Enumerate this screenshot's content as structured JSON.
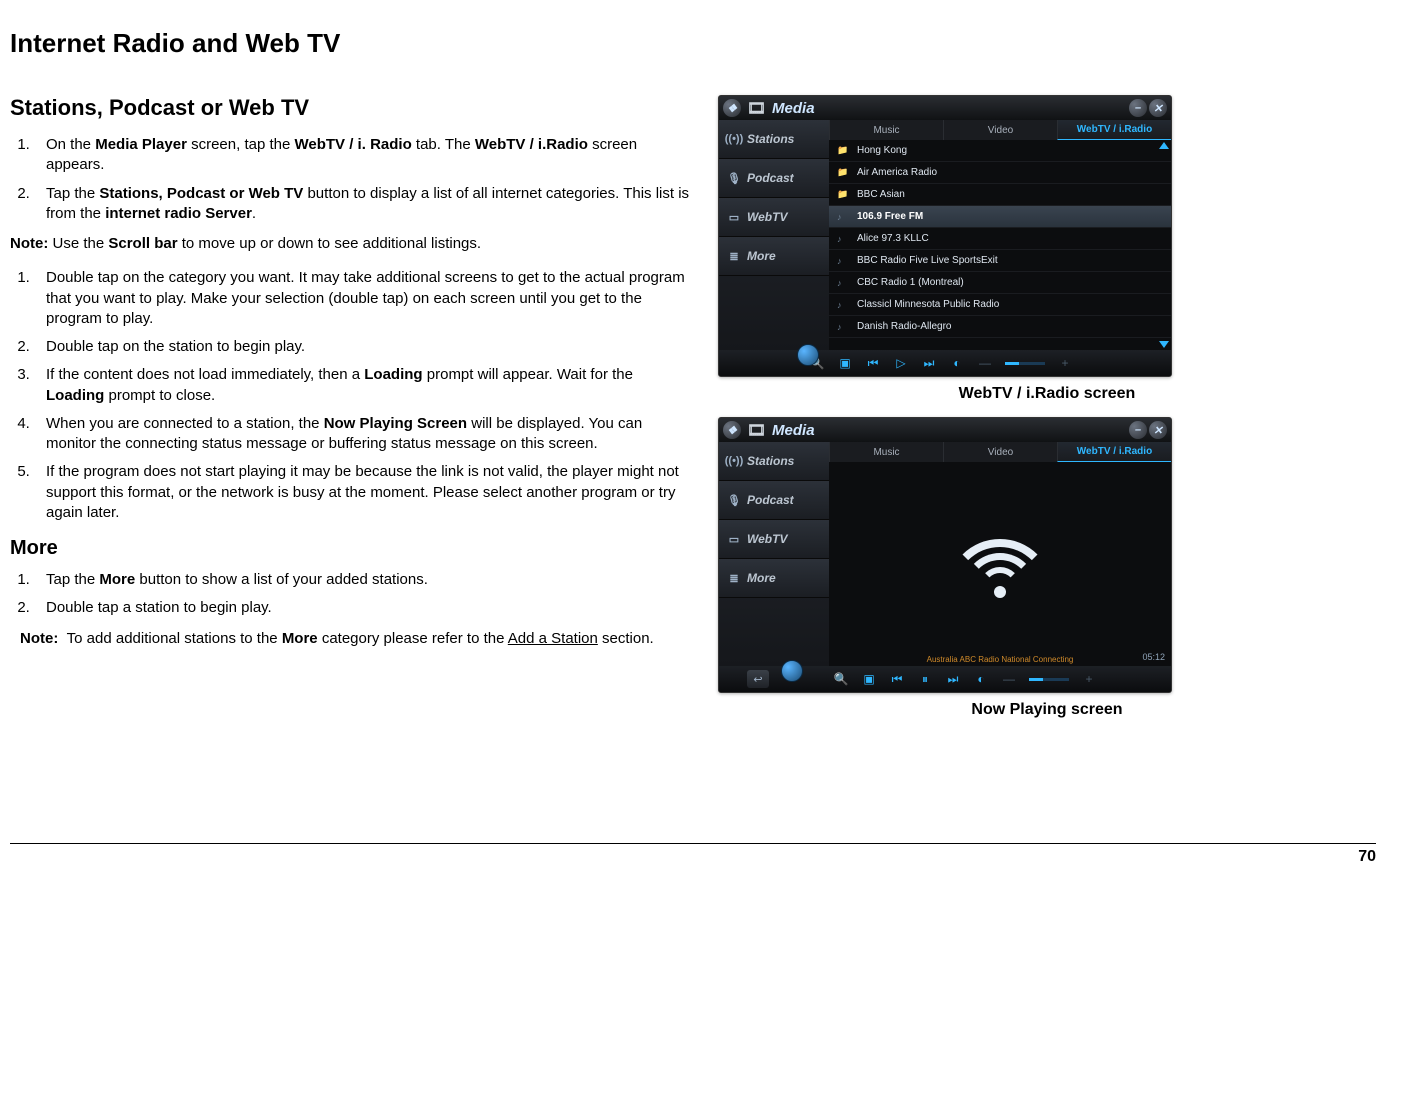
{
  "page_title": "Internet Radio and Web TV",
  "section1_title": "Stations, Podcast or Web TV",
  "intro_list": [
    "On the <b>Media Player</b> screen, tap the <b>WebTV / i. Radio</b> tab.  The <b>WebTV / i.Radio</b> screen appears.",
    "Tap the <b>Stations, Podcast or Web TV</b> button to display a list of all internet categories.  This list is from the <b>internet radio Server</b>."
  ],
  "note1": "<b>Note:</b> Use the <b>Scroll bar</b> to move up or down to see additional listings.",
  "steps_list": [
    "Double tap on the category you want.  It may take additional screens to get to the actual program that you want to play.  Make your selection (double tap) on each screen until you get to the program to play.",
    "Double tap on the station to begin play.",
    "If the content does not load immediately, then a <b>Loading</b> prompt will appear.  Wait for the <b>Loading</b> prompt to close.",
    "When you are connected to a station, the <b>Now Playing Screen</b> will be displayed.  You can monitor the connecting status message or buffering status message on this screen.",
    "If the program does not start playing it may be because the link is not valid, the player might not support this format, or the network is busy at the moment.  Please select another program or try again later."
  ],
  "section2_title": "More",
  "more_list": [
    "Tap the <b>More</b> button to show a list of your added stations.",
    "Double tap a station to begin play."
  ],
  "note2": "<b>Note:</b>&nbsp;&nbsp;To add additional stations to the <b>More</b> category please refer to the <span class='underline'>Add a Station</span> section.",
  "caption1": "WebTV / i.Radio screen",
  "caption2": "Now Playing screen",
  "page_number": "70",
  "screenshot": {
    "window_title": "Media",
    "tabs": [
      "Music",
      "Video",
      "WebTV / i.Radio"
    ],
    "active_tab": 2,
    "sidebar": [
      {
        "icon": "((•))",
        "label": "Stations"
      },
      {
        "icon": "🎙",
        "label": "Podcast"
      },
      {
        "icon": "▭",
        "label": "WebTV"
      },
      {
        "icon": "≣",
        "label": "More"
      }
    ],
    "stations": [
      {
        "label": "Hong Kong",
        "type": "folder"
      },
      {
        "label": "Air America Radio",
        "type": "folder"
      },
      {
        "label": "BBC Asian",
        "type": "folder"
      },
      {
        "label": "106.9 Free FM",
        "type": "station",
        "selected": true
      },
      {
        "label": "Alice 97.3 KLLC",
        "type": "station"
      },
      {
        "label": "BBC Radio Five Live SportsExit",
        "type": "station"
      },
      {
        "label": "CBC Radio 1 (Montreal)",
        "type": "station"
      },
      {
        "label": "Classicl Minnesota Public Radio",
        "type": "station"
      },
      {
        "label": "Danish Radio-Allegro",
        "type": "station"
      }
    ],
    "now_playing": {
      "status": "Australia ABC Radio National Connecting",
      "time": "05:12"
    }
  }
}
